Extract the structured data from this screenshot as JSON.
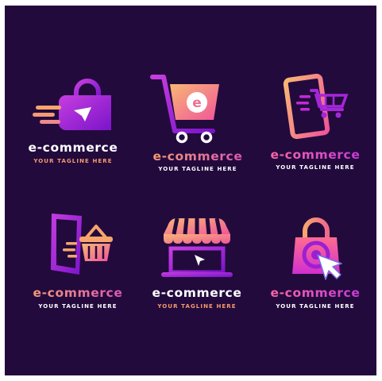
{
  "logos": [
    {
      "brand": "e-commerce",
      "tagline": "YOUR TAGLINE HERE",
      "icon": "shopping-bag-cursor-icon"
    },
    {
      "brand": "e-commerce",
      "tagline": "YOUR TAGLINE HERE",
      "icon": "shopping-cart-letter-e-icon"
    },
    {
      "brand": "e-commerce",
      "tagline": "YOUR TAGLINE HERE",
      "icon": "phone-cart-icon"
    },
    {
      "brand": "e-commerce",
      "tagline": "YOUR TAGLINE HERE",
      "icon": "phone-basket-icon"
    },
    {
      "brand": "e-commerce",
      "tagline": "YOUR TAGLINE HERE",
      "icon": "storefront-laptop-icon"
    },
    {
      "brand": "e-commerce",
      "tagline": "YOUR TAGLINE HERE",
      "icon": "bag-target-cursor-icon"
    }
  ],
  "colors": {
    "background": "#230a3d",
    "purple": "#8e1dd6",
    "magenta": "#c02bd8",
    "pink": "#ff5c9a",
    "orange": "#f7a56d",
    "white": "#ffffff"
  }
}
